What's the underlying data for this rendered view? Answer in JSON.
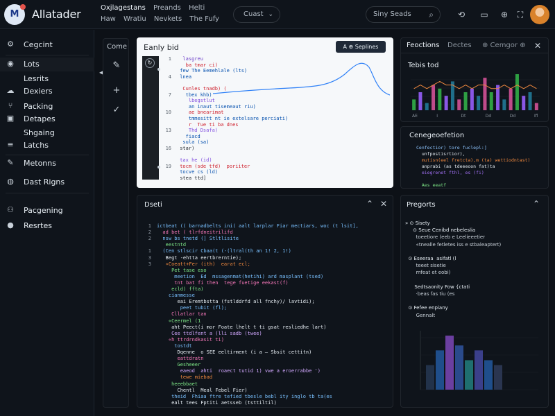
{
  "app": {
    "logo": "M",
    "title": "Allatader",
    "menu_row1": [
      "Oxjlagestans",
      "Preands",
      "Helti"
    ],
    "menu_row2": [
      "Haw",
      "Wratiu",
      "Nevkets",
      "The Fufy"
    ],
    "env_select": "Cuast",
    "search_placeholder": "Siny Seads"
  },
  "sidebar": {
    "items": [
      {
        "label": "Cegcint",
        "icon": "gear-icon",
        "glyph": "⚙"
      },
      {
        "label": "Lots",
        "icon": "circle-icon",
        "glyph": "◉"
      },
      {
        "label": "Lesrits",
        "icon": "",
        "glyph": ""
      },
      {
        "label": "Dexiers",
        "icon": "cloud-icon",
        "glyph": "☁"
      },
      {
        "label": "Packing",
        "icon": "branch-icon",
        "glyph": "⑂"
      },
      {
        "label": "Detapes",
        "icon": "box-icon",
        "glyph": "▣"
      },
      {
        "label": "Shgaing",
        "icon": "",
        "glyph": ""
      },
      {
        "label": "Latchs",
        "icon": "list-icon",
        "glyph": "≡"
      },
      {
        "label": "Metonns",
        "icon": "pen-icon",
        "glyph": "✎"
      },
      {
        "label": "Dast Rigns",
        "icon": "globe-icon",
        "glyph": "◍"
      },
      {
        "label": "Pacgening",
        "icon": "users-icon",
        "glyph": "⚇"
      },
      {
        "label": "Resrtes",
        "icon": "info-icon",
        "glyph": "●"
      }
    ]
  },
  "toolbar": {
    "label": "Come"
  },
  "editor": {
    "title": "Eanly bid",
    "button": "A  ⊕ Seplines",
    "lines": [
      {
        "n": "",
        "t": "  lasgreu",
        "c": "#6e40c9"
      },
      {
        "n": "",
        "t": "   ba tmar ci)",
        "c": "#cf222e"
      },
      {
        "n": "",
        "t": " few The Eemehlale (lts)",
        "c": "#0550ae"
      },
      {
        "n": "",
        "t": " lnea",
        "c": "#0550ae"
      },
      {
        "n": "",
        "t": "",
        "c": "#24292f"
      },
      {
        "n": "",
        "t": "  Cunles tnadb) (",
        "c": "#cf222e"
      },
      {
        "n": "",
        "t": "   tbex khb)",
        "c": "#0550ae"
      },
      {
        "n": "",
        "t": "    lbegstlut",
        "c": "#8250df"
      },
      {
        "n": "",
        "t": "    an inaut tisemeaut riu)",
        "c": "#0550ae"
      },
      {
        "n": "",
        "t": "    ae bnearimat",
        "c": "#cf222e"
      },
      {
        "n": "",
        "t": "    tmmesitt nt ie extelsare perciati)",
        "c": "#0550ae"
      },
      {
        "n": "",
        "t": "    r  Tue ti ba dnes",
        "c": "#cf222e"
      },
      {
        "n": "",
        "t": "    Thd Dsafa)",
        "c": "#8250df"
      },
      {
        "n": "",
        "t": "   fiacd",
        "c": "#0550ae"
      },
      {
        "n": "",
        "t": "  sula (sa)",
        "c": "#0550ae"
      },
      {
        "n": "",
        "t": " star)",
        "c": "#24292f"
      },
      {
        "n": "",
        "t": "",
        "c": "#24292f"
      },
      {
        "n": "",
        "t": " tax he (id)",
        "c": "#8250df"
      },
      {
        "n": "",
        "t": " tocm (sde tfd)  poriiter",
        "c": "#cf222e"
      },
      {
        "n": "",
        "t": " tocve cs (ld)",
        "c": "#0550ae"
      },
      {
        "n": "",
        "t": " stea ttd]",
        "c": "#24292f"
      }
    ]
  },
  "preview": {
    "tabs": [
      "Feoctions",
      "Dectes",
      "⊕ Cemgor ⊕"
    ],
    "subtitle": "Tebis tod",
    "mini_ticks": [
      "AE",
      "I",
      "Dt",
      "Dd",
      "Dd",
      "Ifl"
    ]
  },
  "config": {
    "title": "Cenegeoefetion",
    "lines": [
      {
        "t": "Cenfectior) tore fuclepl:]",
        "c": "#8ec5ff"
      },
      {
        "t": "  unfpostisrtior),",
        "c": "#e6edf3"
      },
      {
        "t": "  mutisn(eel fretcta),m (ta) wettiodntast)",
        "c": "#f0883e"
      },
      {
        "t": "  anprabi (as tdeeeoon fat)ta",
        "c": "#e6edf3"
      },
      {
        "t": "  eiegrenet fthl, es (fi)",
        "c": "#a371f7"
      },
      {
        "t": "",
        "c": "#e6edf3"
      },
      {
        "t": "  Aes eeatf",
        "c": "#7ee787"
      }
    ]
  },
  "output": {
    "title": "Dseti",
    "lines": [
      {
        "n": "1",
        "t": "ictbeat (( barnadbelts ini( aalt larplar Fiar mectiars, woc (t lsit],",
        "c": "#79c0ff",
        "i": 0
      },
      {
        "n": "2",
        "t": "  ad bet ( tlrfdneitrilifd",
        "c": "#f778ba",
        "i": 0
      },
      {
        "n": "2",
        "t": "  nsw bs tnetd (] Stltlisite",
        "c": "#79c0ff",
        "i": 0
      },
      {
        "n": "",
        "t": "   eestntd",
        "c": "#7ee787",
        "i": 0
      },
      {
        "n": "1",
        "t": "  (Cen stlscir Cbaa(t (-(ltral(th an 1! 2, 1!)",
        "c": "#79c0ff",
        "i": 0
      },
      {
        "n": "3",
        "t": "   Begt -ehtta eertbrerntie);",
        "c": "#e6edf3",
        "i": 0
      },
      {
        "n": "3",
        "t": "   «Coeatt+Fer (ith)  earat ecl;",
        "c": "#f0883e",
        "i": 0
      },
      {
        "n": "",
        "t": "     Pet tase eso",
        "c": "#7ee787",
        "i": 0
      },
      {
        "n": "",
        "t": "      meetion  Ed  mssagenmat(hetihi) ard masplant (tsed)",
        "c": "#79c0ff",
        "i": 0
      },
      {
        "n": "",
        "t": "      tnt bat fi then  tege fuetige eekast(f)",
        "c": "#f778ba",
        "i": 0
      },
      {
        "n": "",
        "t": "     ecld) ffta)",
        "c": "#7ee787",
        "i": 0
      },
      {
        "n": "",
        "t": "    cianmesse",
        "c": "#79c0ff",
        "i": 0
      },
      {
        "n": "",
        "t": "       eai Eremtbstta (fstlddrfd all fnchy)/ lavtidi);",
        "c": "#e6edf3",
        "i": 0
      },
      {
        "n": "",
        "t": "        peet tubit (fl);",
        "c": "#79c0ff",
        "i": 0
      },
      {
        "n": "",
        "t": "     Cllatlar tan",
        "c": "#f778ba",
        "i": 0
      },
      {
        "n": "",
        "t": "    «Ceermel (1",
        "c": "#7ee787",
        "i": 0
      },
      {
        "n": "",
        "t": "     aht Peect(i mor Foate lhelt t ti gsat resliedhe lart)",
        "c": "#e6edf3",
        "i": 0
      },
      {
        "n": "",
        "t": "     Cee ttdlfent a (lli sadb (twee)",
        "c": "#d2a8ff",
        "i": 0
      },
      {
        "n": "",
        "t": "    «h ttrdrndkasit ti)",
        "c": "#f778ba",
        "i": 0
      },
      {
        "n": "",
        "t": "      tostdt",
        "c": "#79c0ff",
        "i": 0
      },
      {
        "n": "",
        "t": "       Dqenne  o SEE eeltirment (i a — Sbsit cettitn)",
        "c": "#e6edf3",
        "i": 0
      },
      {
        "n": "",
        "t": "       eattdratn",
        "c": "#f778ba",
        "i": 0
      },
      {
        "n": "",
        "t": "       Gesheeer",
        "c": "#7ee787",
        "i": 0
      },
      {
        "n": "",
        "t": "        eaeod  ahti  roaect tutid 1) vwe a eroerrabbe ')",
        "c": "#d2a8ff",
        "i": 0
      },
      {
        "n": "",
        "t": "        tewe miebad",
        "c": "#f0883e",
        "i": 0
      },
      {
        "n": "",
        "t": "     heeebbaet",
        "c": "#7ee787",
        "i": 0
      },
      {
        "n": "",
        "t": "       Chentl  Meal Febel Fier)",
        "c": "#e6edf3",
        "i": 0
      },
      {
        "n": "",
        "t": "     theid  Fhiaa ftre tefied tbesle bebl ity inglo tb ta(es",
        "c": "#79c0ff",
        "i": 0
      },
      {
        "n": "",
        "t": "     ealt tees Fptiti aetsseb (tsttiltil)",
        "c": "#e6edf3",
        "i": 0
      }
    ]
  },
  "props": {
    "title": "Pregorts",
    "lines": [
      {
        "t": "» ⊙ Sisety",
        "c": "#e6edf3"
      },
      {
        "t": "     ⊙ Seue Cenibd nebeleslia",
        "c": "#e6edf3"
      },
      {
        "t": "       toeetiore (eeb e Leelieeetier",
        "c": "#c9d1d9"
      },
      {
        "t": "       «tnealle fetletes iss e stbaleaptert)",
        "c": "#c9d1d9"
      },
      {
        "t": "",
        "c": "#c9d1d9"
      },
      {
        "t": "  ⊙ Eseeraa  asifatl (l",
        "c": "#e6edf3"
      },
      {
        "t": "       teeet sisetie",
        "c": "#c9d1d9"
      },
      {
        "t": "       mfeat et eobi)",
        "c": "#c9d1d9"
      },
      {
        "t": "",
        "c": "#c9d1d9"
      },
      {
        "t": "      Sedtsaonity Fow {ctati",
        "c": "#e6edf3"
      },
      {
        "t": "       ·beas fas tiu (es",
        "c": "#c9d1d9"
      },
      {
        "t": "",
        "c": "#c9d1d9"
      },
      {
        "t": "  ⊙ Fefee enpiany",
        "c": "#e6edf3"
      },
      {
        "t": "       Gennalt",
        "c": "#c9d1d9"
      }
    ]
  },
  "colors": {
    "bg": "#0d1117",
    "panel": "#0f141b",
    "accent_curve": "#2f81f7",
    "bar_green": "#2ea043",
    "bar_purple": "#8957e5",
    "bar_teal": "#1f6f8b",
    "bar_blue": "#1f6feb",
    "bar_pink": "#bf4b8a",
    "line_orange": "#f0883e"
  },
  "chart_mini": {
    "type": "bar",
    "values": [
      3,
      5,
      2,
      7,
      6,
      4,
      8,
      3,
      5,
      6,
      4,
      9,
      5,
      7,
      3,
      6,
      10,
      4,
      5,
      2
    ],
    "line": [
      6,
      7,
      6,
      7,
      8,
      7,
      7,
      6,
      7,
      6,
      7,
      7,
      6,
      6,
      7,
      6,
      7,
      6,
      7,
      6
    ]
  },
  "chart_props": {
    "type": "bar",
    "values": [
      5,
      8,
      11,
      9,
      6,
      8,
      6,
      5
    ],
    "colors": [
      "#22324a",
      "#1f4e8b",
      "#6b3fa0",
      "#2a4a8b",
      "#1f6f6f",
      "#3b3f8a",
      "#1f4e8b",
      "#2a3550"
    ]
  }
}
